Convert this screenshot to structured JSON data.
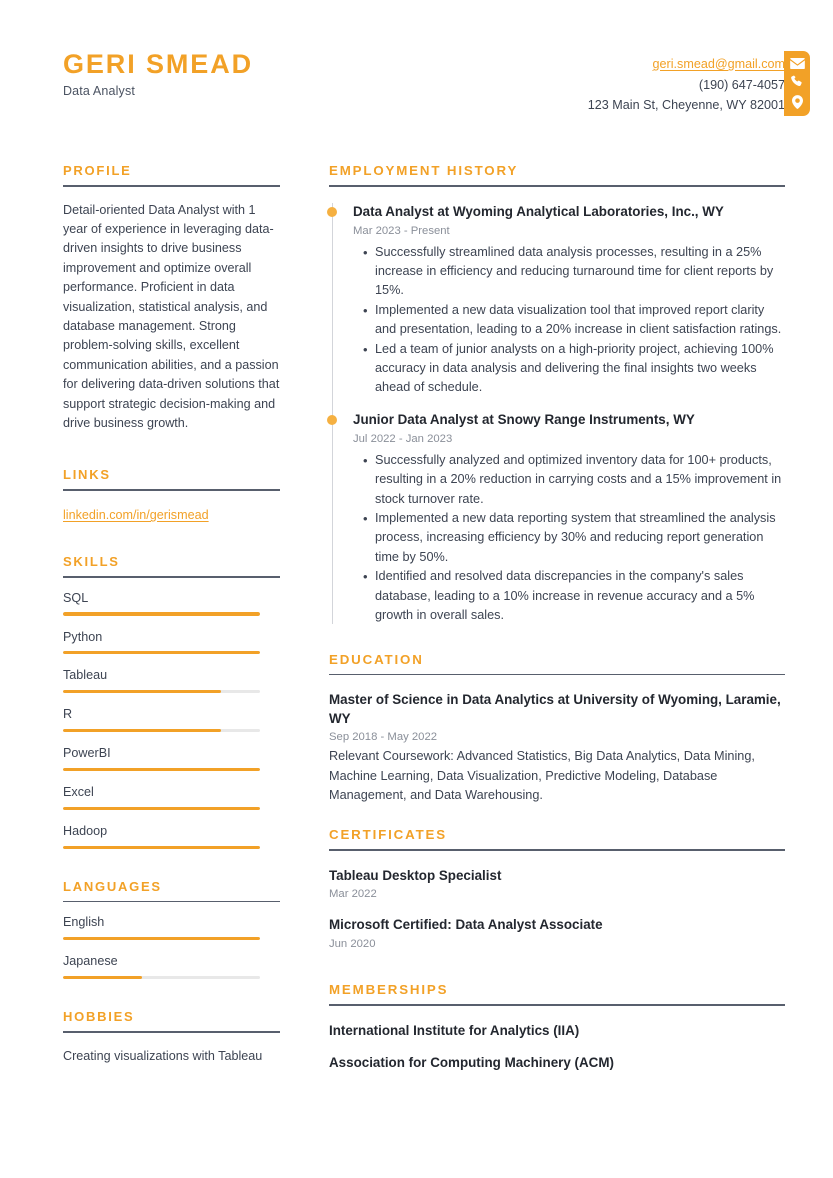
{
  "header": {
    "name": "GERI SMEAD",
    "title": "Data Analyst",
    "email": "geri.smead@gmail.com",
    "phone": "(190) 647-4057",
    "address": "123 Main St, Cheyenne, WY 82001",
    "icons": [
      "envelope-icon",
      "phone-icon",
      "location-pin-icon"
    ]
  },
  "colors": {
    "accent": "#f2a127",
    "accent_dot": "#f5b041",
    "text": "#3d4452",
    "heading_rule": "#585f6d",
    "muted": "#8a8f99",
    "track": "#e8e8e8"
  },
  "left": {
    "profile": {
      "heading": "PROFILE",
      "text": "Detail-oriented Data Analyst with 1 year of experience in leveraging data-driven insights to drive business improvement and optimize overall performance. Proficient in data visualization, statistical analysis, and database management. Strong problem-solving skills, excellent communication abilities, and a passion for delivering data-driven solutions that support strategic decision-making and drive business growth."
    },
    "links": {
      "heading": "LINKS",
      "items": [
        {
          "label": "linkedin.com/in/gerismead"
        }
      ]
    },
    "skills": {
      "heading": "SKILLS",
      "items": [
        {
          "label": "SQL",
          "level": 100
        },
        {
          "label": "Python",
          "level": 100
        },
        {
          "label": "Tableau",
          "level": 80
        },
        {
          "label": "R",
          "level": 80
        },
        {
          "label": "PowerBI",
          "level": 100
        },
        {
          "label": "Excel",
          "level": 100
        },
        {
          "label": "Hadoop",
          "level": 100
        }
      ]
    },
    "languages": {
      "heading": "LANGUAGES",
      "items": [
        {
          "label": "English",
          "level": 100
        },
        {
          "label": "Japanese",
          "level": 40
        }
      ]
    },
    "hobbies": {
      "heading": "HOBBIES",
      "text": "Creating visualizations with Tableau"
    }
  },
  "right": {
    "employment": {
      "heading": "EMPLOYMENT HISTORY",
      "entries": [
        {
          "title": "Data Analyst at Wyoming Analytical Laboratories, Inc., WY",
          "date": "Mar 2023 - Present",
          "bullets": [
            "Successfully streamlined data analysis processes, resulting in a 25% increase in efficiency and reducing turnaround time for client reports by 15%.",
            "Implemented a new data visualization tool that improved report clarity and presentation, leading to a 20% increase in client satisfaction ratings.",
            "Led a team of junior analysts on a high-priority project, achieving 100% accuracy in data analysis and delivering the final insights two weeks ahead of schedule."
          ]
        },
        {
          "title": "Junior Data Analyst at Snowy Range Instruments, WY",
          "date": "Jul 2022 - Jan 2023",
          "bullets": [
            "Successfully analyzed and optimized inventory data for 100+ products, resulting in a 20% reduction in carrying costs and a 15% improvement in stock turnover rate.",
            "Implemented a new data reporting system that streamlined the analysis process, increasing efficiency by 30% and reducing report generation time by 50%.",
            "Identified and resolved data discrepancies in the company's sales database, leading to a 10% increase in revenue accuracy and a 5% growth in overall sales."
          ]
        }
      ]
    },
    "education": {
      "heading": "EDUCATION",
      "entries": [
        {
          "title": "Master of Science in Data Analytics at University of Wyoming, Laramie, WY",
          "date": "Sep 2018 - May 2022",
          "description": "Relevant Coursework: Advanced Statistics, Big Data Analytics, Data Mining, Machine Learning, Data Visualization, Predictive Modeling, Database Management, and Data Warehousing."
        }
      ]
    },
    "certificates": {
      "heading": "CERTIFICATES",
      "entries": [
        {
          "title": "Tableau Desktop Specialist",
          "date": "Mar 2022"
        },
        {
          "title": "Microsoft Certified: Data Analyst Associate",
          "date": "Jun 2020"
        }
      ]
    },
    "memberships": {
      "heading": "MEMBERSHIPS",
      "entries": [
        {
          "title": "International Institute for Analytics (IIA)"
        },
        {
          "title": "Association for Computing Machinery (ACM)"
        }
      ]
    }
  }
}
